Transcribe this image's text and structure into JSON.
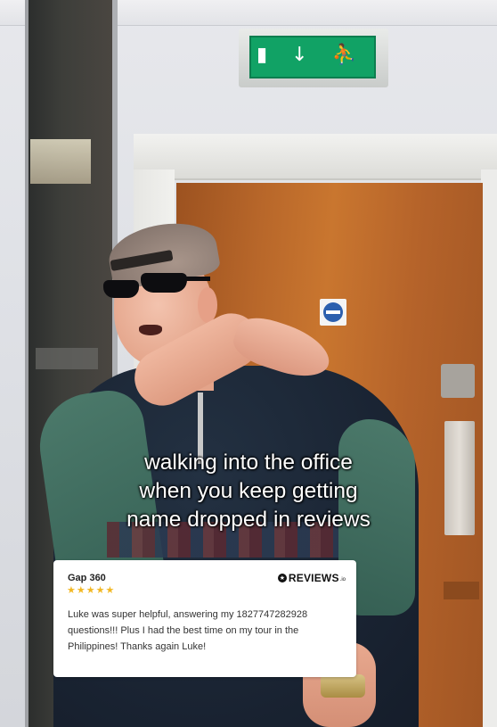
{
  "caption": {
    "lines": [
      "walking into the office",
      "when you keep getting",
      "name dropped in reviews"
    ]
  },
  "review": {
    "company": "Gap 360",
    "rating": 5,
    "stars": "★★★★★",
    "brand": {
      "word": "REVIEWS",
      "suffix": ".io",
      "icon": "star-circle-icon"
    },
    "text": "Luke was super helpful, answering my 1827747282928 questions!!! Plus I had the best time on my tour in the Philippines! Thanks again Luke!"
  },
  "colors": {
    "caption_text": "#ffffff",
    "card_bg": "#ffffff",
    "star": "#f2b824",
    "exit_sign": "#11a265"
  },
  "background": {
    "exit_sign_glyphs": "▮ ↓ ⛹"
  }
}
